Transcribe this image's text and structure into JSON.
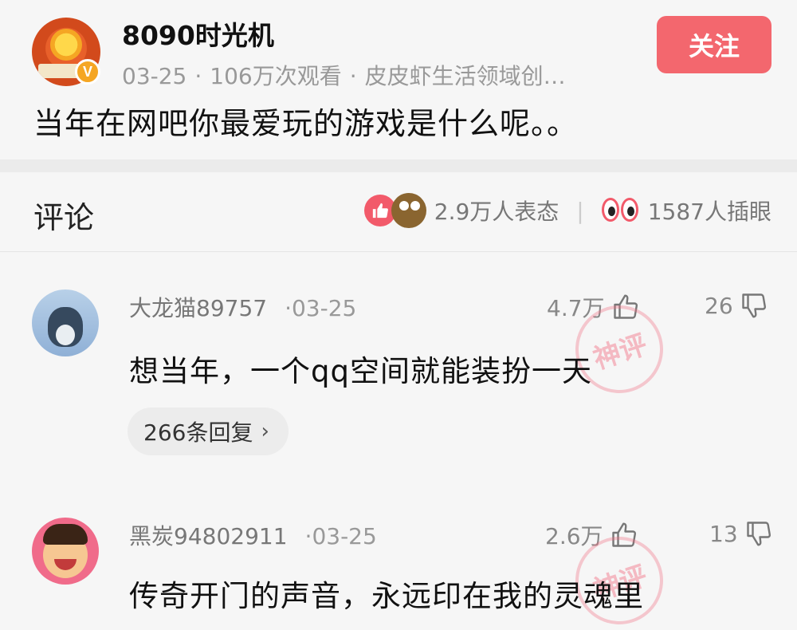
{
  "post": {
    "author": "8090时光机",
    "date": "03-25",
    "views": "106万次观看",
    "domain": "皮皮虾生活领域创…",
    "follow_label": "关注",
    "text": "当年在网吧你最爱玩的游戏是什么呢。。",
    "verified_mark": "V"
  },
  "comments_header": {
    "title": "评论",
    "reactions": "2.9万人表态",
    "separator": "|",
    "eyes": "1587人插眼"
  },
  "comments": [
    {
      "user": "大龙猫89757",
      "date": "03-25",
      "likes": "4.7万",
      "dislikes": "26",
      "text": "想当年，一个qq空间就能装扮一天",
      "replies": "266条回复",
      "stamp": "神评"
    },
    {
      "user": "黑炭94802911",
      "date": "03-25",
      "likes": "2.6万",
      "dislikes": "13",
      "text": "传奇开门的声音，永远印在我的灵魂里",
      "stamp": "神评"
    }
  ],
  "colors": {
    "accent": "#f3676e",
    "verify": "#f5a623"
  }
}
